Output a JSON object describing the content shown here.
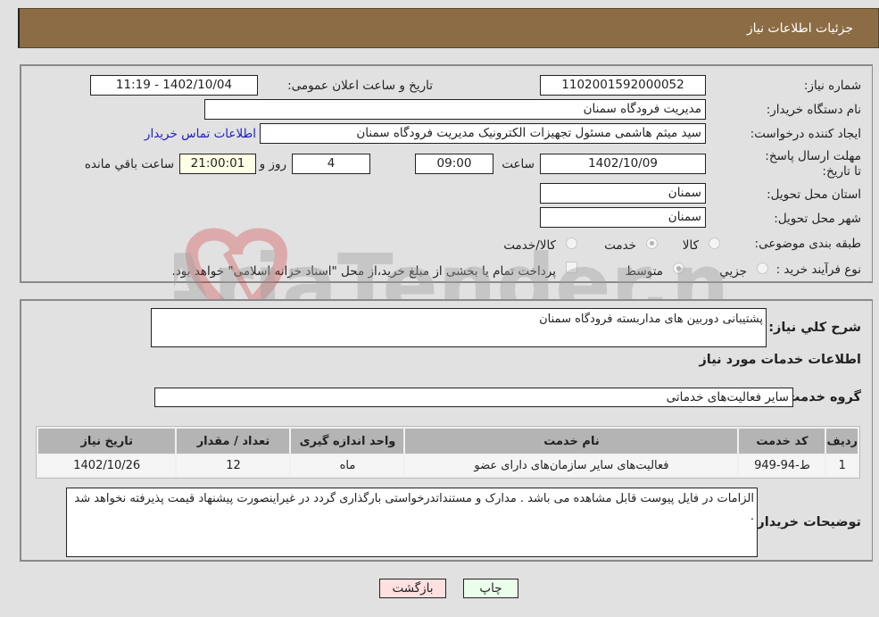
{
  "header": {
    "title": "جزئیات اطلاعات نیاز"
  },
  "fields": {
    "need_number": {
      "label": "شماره نیاز:",
      "value": "1102001592000052"
    },
    "announce_datetime": {
      "label": "تاریخ و ساعت اعلان عمومی:",
      "value": "1402/10/04 - 11:19"
    },
    "buyer_org": {
      "label": "نام دستگاه خریدار:",
      "value": "مدیریت فرودگاه سمنان"
    },
    "requester": {
      "label": "ایجاد کننده درخواست:",
      "value": "سید میثم هاشمی مسئول تجهیزات الکترونیک مدیریت فرودگاه سمنان"
    },
    "buyer_contact_link": "اطلاعات تماس خریدار",
    "deadline": {
      "label": "مهلت ارسال پاسخ: تا تاریخ:",
      "date": "1402/10/09",
      "time_label": "ساعت",
      "time": "09:00",
      "days": "4",
      "days_label": "روز و",
      "remaining": "21:00:01",
      "remaining_label": "ساعت باقي مانده"
    },
    "province": {
      "label": "استان محل تحویل:",
      "value": "سمنان"
    },
    "city": {
      "label": "شهر محل تحویل:",
      "value": "سمنان"
    },
    "category": {
      "label": "طبقه بندی موضوعی:",
      "options": [
        "کالا",
        "خدمت",
        "کالا/خدمت"
      ],
      "selected": "خدمت"
    },
    "purchase_type": {
      "label": "نوع فرآیند خرید :",
      "options": [
        "جزيي",
        "متوسط"
      ],
      "selected": "متوسط",
      "treasury_note": "پرداخت تمام یا بخشی از مبلغ خرید،از محل \"اسناد خزانه اسلامی\" خواهد بود."
    }
  },
  "details": {
    "summary_label": "شرح کلي نیاز:",
    "summary_value": "پشتیبانی دوربین های مداربسته فرودگاه سمنان",
    "services_heading": "اطلاعات خدمات مورد نیاز",
    "service_group_label": "گروه خدمت:",
    "service_group_value": "سایر فعالیت‌های خدماتی",
    "table": {
      "headers": [
        "ردیف",
        "کد خدمت",
        "نام خدمت",
        "واحد اندازه گیری",
        "تعداد / مقدار",
        "تاریخ نیاز"
      ],
      "rows": [
        [
          "1",
          "ط-94-949",
          "فعالیت‌های سایر سازمان‌های دارای عضو",
          "ماه",
          "12",
          "1402/10/26"
        ]
      ]
    },
    "buyer_notes_label": "توضیحات خریدار:",
    "buyer_notes_value": "الزامات در فایل پیوست قابل مشاهده می باشد . مدارک و مستنداتدرخواستی بارگذاری گردد در غیراینصورت پیشنهاد قیمت پذیرفته نخواهد شد ."
  },
  "buttons": {
    "print": "چاپ",
    "back": "بازگشت"
  },
  "watermark": "AriaTender.neT",
  "colors": {
    "header_bg": "#8c6c44",
    "link": "#2020c0",
    "print_bg": "#eaffea",
    "back_bg": "#ffe0e0"
  }
}
